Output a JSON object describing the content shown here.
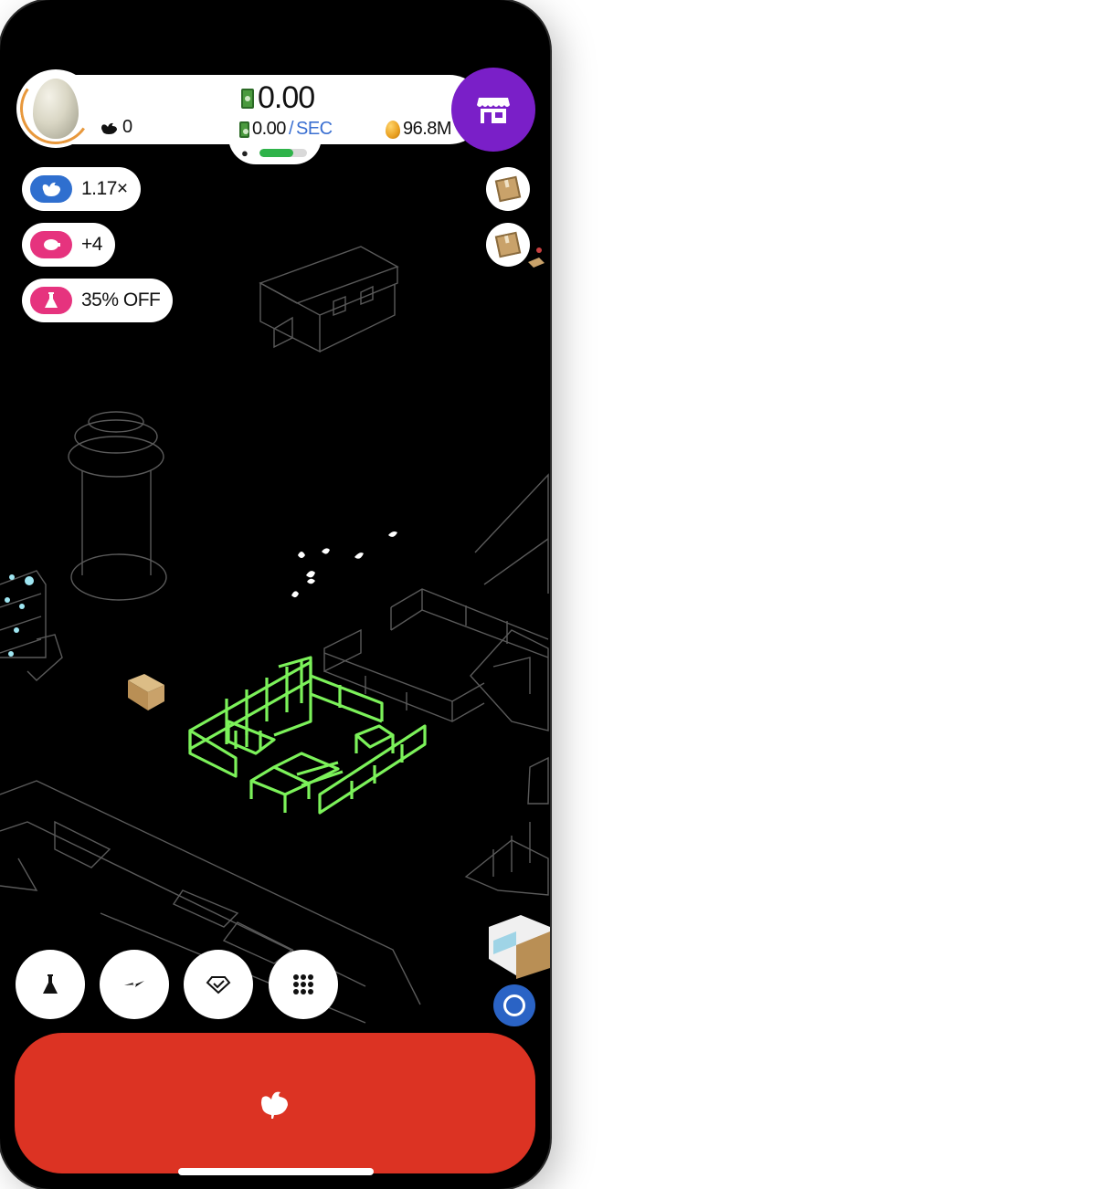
{
  "header": {
    "chicken_count": "0",
    "money_balance": "0.00",
    "money_rate_value": "0.00",
    "money_rate_separator": "/",
    "money_rate_unit": "SEC",
    "egg_total": "96.8M",
    "hab_progress_fraction": 0.72
  },
  "boosts": {
    "chicken_multiplier": "1.17×",
    "piggy_bonus": "+4",
    "research_discount": "35% OFF"
  },
  "colors": {
    "shop_button": "#7a1fc8",
    "hatch_button": "#dc3323",
    "boost_blue": "#2f6fcf",
    "boost_pink": "#e6337e",
    "farm_wireframe": "#7cf25a",
    "progress_fill": "#2fb34a"
  },
  "icons": {
    "shop": "shop-icon",
    "research": "flask-icon",
    "boost": "lightning-icon",
    "artifacts": "gem-icon",
    "menu": "grid-icon",
    "hatch": "chicken-icon"
  }
}
